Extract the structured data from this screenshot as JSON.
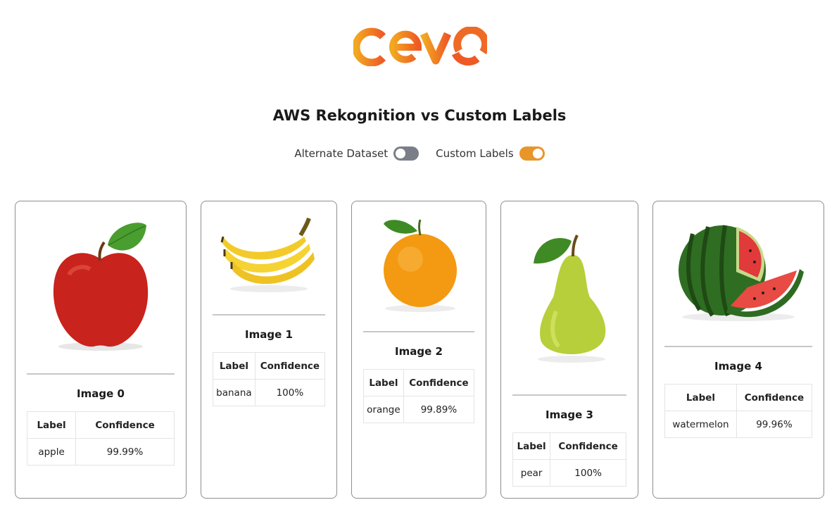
{
  "brand": {
    "logo_text": "cevo",
    "logo_color_start": "#f2a821",
    "logo_color_end": "#ef5a24"
  },
  "header": {
    "title": "AWS Rekognition vs Custom Labels"
  },
  "toggles": [
    {
      "label": "Alternate Dataset",
      "state": "off",
      "color": "#7a7f87"
    },
    {
      "label": "Custom Labels",
      "state": "on",
      "color": "#e8962a"
    }
  ],
  "table_headers": {
    "label": "Label",
    "confidence": "Confidence"
  },
  "images": [
    {
      "title": "Image 0",
      "fruit_icon": "apple-image",
      "label": "apple",
      "confidence": "99.99%"
    },
    {
      "title": "Image 1",
      "fruit_icon": "banana-image",
      "label": "banana",
      "confidence": "100%"
    },
    {
      "title": "Image 2",
      "fruit_icon": "orange-image",
      "label": "orange",
      "confidence": "99.89%"
    },
    {
      "title": "Image 3",
      "fruit_icon": "pear-image",
      "label": "pear",
      "confidence": "100%"
    },
    {
      "title": "Image 4",
      "fruit_icon": "watermelon-image",
      "label": "watermelon",
      "confidence": "99.96%"
    }
  ]
}
